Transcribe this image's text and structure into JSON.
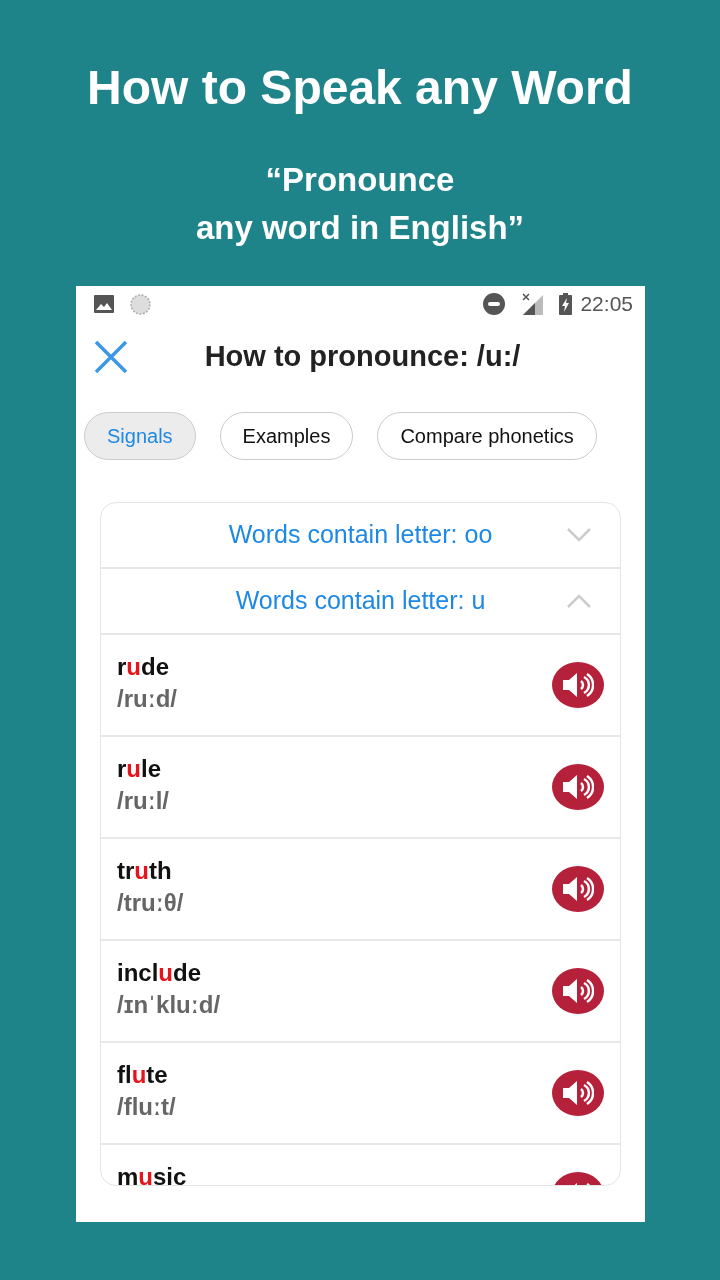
{
  "headline": "How to Speak any Word",
  "subtitle": [
    "“Pronounce",
    "any word in English”"
  ],
  "status_bar": {
    "time": "22:05"
  },
  "header": {
    "title": "How to pronounce: /u:/"
  },
  "tabs": [
    {
      "label": "Signals",
      "selected": true
    },
    {
      "label": "Examples",
      "selected": false
    },
    {
      "label": "Compare phonetics",
      "selected": false
    }
  ],
  "sections": [
    {
      "title": "Words contain letter: oo",
      "expanded": false
    },
    {
      "title": "Words contain letter: u",
      "expanded": true,
      "words": [
        {
          "prefix": "r",
          "highlight": "u",
          "suffix": "de",
          "phonetic": "/ruːd/"
        },
        {
          "prefix": "r",
          "highlight": "u",
          "suffix": "le",
          "phonetic": "/ruːl/"
        },
        {
          "prefix": "tr",
          "highlight": "u",
          "suffix": "th",
          "phonetic": "/truːθ/"
        },
        {
          "prefix": "incl",
          "highlight": "u",
          "suffix": "de",
          "phonetic": "/ɪnˈkluːd/"
        },
        {
          "prefix": "fl",
          "highlight": "u",
          "suffix": "te",
          "phonetic": "/fluːt/"
        },
        {
          "prefix": "m",
          "highlight": "u",
          "suffix": "sic"
        }
      ]
    }
  ]
}
